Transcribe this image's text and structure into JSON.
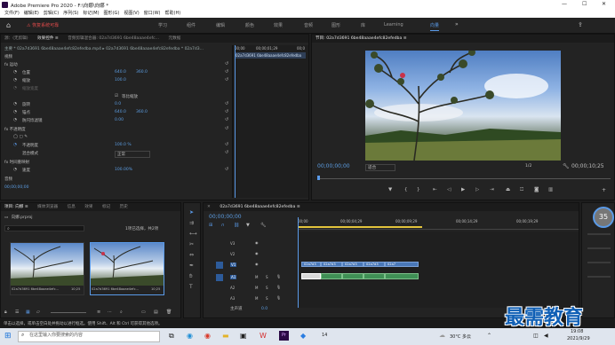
{
  "app": {
    "title": "Adobe Premiere Pro 2020 - F:\\向娜\\向娜 *"
  },
  "menu": [
    "文件(F)",
    "编辑(E)",
    "剪辑(C)",
    "序列(S)",
    "标记(M)",
    "图形(G)",
    "视图(V)",
    "窗口(W)",
    "帮助(H)"
  ],
  "workspace": {
    "alert": "⚠ 恢复系统可靠",
    "items": [
      "学习",
      "组件",
      "编辑",
      "颜色",
      "效果",
      "音频",
      "图形",
      "库",
      "Learning",
      "向量"
    ],
    "active_index": 9
  },
  "effect_controls": {
    "tabs": [
      "源：(无剪辑)",
      "效果控件 ≡",
      "音频剪辑混合器: 02a7d3691 6be48aaae4efc...",
      "元数据"
    ],
    "clip_path": "主要 * 02a7d3691 6be48aaae4efc82efedba.mp4 ▸ 02a7d3691 6be48aaae4efc82efedba * 02a7d3...",
    "time_ruler": [
      "00;00",
      "00;00;01;29",
      "00;0"
    ],
    "clip_label": "02a7d3691 6be48aaae4efc82efedba",
    "section_video": "视频",
    "section_motion": "fx 运动",
    "rows": [
      {
        "label": "位置",
        "v1": "640.0",
        "v2": "360.0"
      },
      {
        "label": "缩放",
        "v1": "100.0",
        "v2": ""
      },
      {
        "label": "缩放宽度",
        "v1": "",
        "v2": ""
      },
      {
        "label": "等比缩放",
        "v1": "☑",
        "v2": ""
      },
      {
        "label": "旋转",
        "v1": "0.0",
        "v2": ""
      },
      {
        "label": "锚点",
        "v1": "640.0",
        "v2": "360.0"
      },
      {
        "label": "防闪烁滤镜",
        "v1": "0.00",
        "v2": ""
      }
    ],
    "section_opacity": "fx 不透明度",
    "opacity": {
      "label": "不透明度",
      "value": "100.0 %"
    },
    "blend": {
      "label": "混合模式",
      "value": "正常"
    },
    "section_time": "fx 时间重映射",
    "speed": {
      "label": "速度",
      "value": "100.00%"
    },
    "section_audio": "音频",
    "timecode": "00;00;00;00"
  },
  "program": {
    "title": "节目: 02a7d3691 6be48aaae4efc82efedba ≡",
    "timecode_left": "00;00;00;00",
    "fit": "适合",
    "ratio": "1/2",
    "timecode_right": "00;00;10;25"
  },
  "project": {
    "tabs": [
      "项目: 向娜 ≡",
      "媒体浏览器",
      "信息",
      "效果",
      "标记",
      "历史"
    ],
    "path": "向娜.prproj",
    "selection": "1项已选择，共2项",
    "items": [
      {
        "name": "02a7d3691 6be48aaae4efc...",
        "duration": "10;25"
      },
      {
        "name": "02a7d3691 6be48aaae4efc...",
        "duration": "10;25"
      }
    ]
  },
  "timeline": {
    "title": "02a7d3691 6be48aaae4efc82efedba ≡",
    "timecode": "00;00;00;00",
    "ruler": [
      "00;00",
      "00;00;04;29",
      "00;00;09;29",
      "00;00;14;29",
      "00;00;19;29"
    ],
    "video_tracks": [
      "V3",
      "V2",
      "V1"
    ],
    "audio_tracks": [
      "A1",
      "A2",
      "A3"
    ],
    "master": {
      "label": "主声道",
      "value": "0.0"
    },
    "clip_labels": [
      "02a7d3",
      "02a7d3",
      "02a7d3",
      "02a7d3",
      "02a7"
    ],
    "percentage": "35"
  },
  "status": "单击以选择，或单击空白处并拖动以进行框选。使用 Shift、Alt 和 Ctrl 可获得其他选项。",
  "taskbar": {
    "search": "在这里输入你要搜索的内容",
    "weather": "30°C 多云",
    "time": "19:08",
    "date": "2021/9/29",
    "app_badge": "14"
  },
  "watermark": "最需教育",
  "colors": {
    "accent": "#5a9ae8",
    "panel": "#232323",
    "video_clip": "#4a78b8",
    "audio_clip": "#3f8f55",
    "alert": "#e24b4b"
  }
}
